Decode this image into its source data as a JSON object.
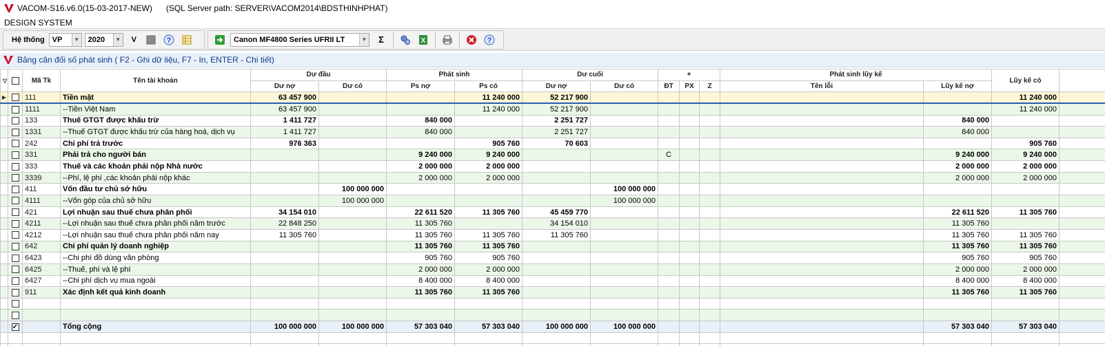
{
  "window": {
    "title": "VACOM-S16.v6.0(15-03-2017-NEW)",
    "sql_path": "(SQL Server path: SERVER\\VACOM2014\\BDSTHINHPHAT)"
  },
  "menu": {
    "label": "DESIGN SYSTEM"
  },
  "toolbar": {
    "system_label": "Hệ thống",
    "unit_value": "VP",
    "year_value": "2020",
    "v_label": "V",
    "printer_value": "Canon MF4800 Series UFRII LT",
    "sigma_label": "Σ"
  },
  "panel": {
    "title": "Bảng cân đối số phát sinh ( F2 - Ghi dữ liệu, F7 - In, ENTER - Chi tiết)"
  },
  "table": {
    "headers": {
      "ma_tk": "Mã Tk",
      "ten_tk": "Tên tài khoản",
      "du_dau": "Dư đầu",
      "phat_sinh": "Phát sinh",
      "du_cuoi": "Dư cuối",
      "plus": "+",
      "ps_luy_ke": "Phát sinh lũy kế",
      "luy_ke_co": "Lũy kế có",
      "du_no": "Dư nợ",
      "du_co": "Dư có",
      "ps_no": "Ps nợ",
      "ps_co": "Ps có",
      "du_no2": "Dư nợ",
      "du_co2": "Dư có",
      "dt": "ĐT",
      "px": "PX",
      "z": "Z",
      "ten_loi": "Tên lỗi",
      "luy_ke_no": "Lũy kế nợ"
    },
    "rows": [
      {
        "code": "111",
        "name": "Tiền mặt",
        "du_no": "63 457 900",
        "du_co": "",
        "ps_no": "",
        "ps_co": "11 240 000",
        "dc_no": "52 217 900",
        "dc_co": "",
        "dt": "",
        "px": "",
        "z": "",
        "loi": "",
        "lk_no": "",
        "lk_co": "11 240 000",
        "bold": true
      },
      {
        "code": "1111",
        "name": "--Tiền Việt Nam",
        "du_no": "63 457 900",
        "du_co": "",
        "ps_no": "",
        "ps_co": "11 240 000",
        "dc_no": "52 217 900",
        "dc_co": "",
        "dt": "",
        "px": "",
        "z": "",
        "loi": "",
        "lk_no": "",
        "lk_co": "11 240 000",
        "bold": false
      },
      {
        "code": "133",
        "name": "Thuế GTGT được khấu trừ",
        "du_no": "1 411 727",
        "du_co": "",
        "ps_no": "840 000",
        "ps_co": "",
        "dc_no": "2 251 727",
        "dc_co": "",
        "dt": "",
        "px": "",
        "z": "",
        "loi": "",
        "lk_no": "840 000",
        "lk_co": "",
        "bold": true
      },
      {
        "code": "1331",
        "name": "--Thuế GTGT được khấu trừ của hàng hoá, dịch vụ",
        "du_no": "1 411 727",
        "du_co": "",
        "ps_no": "840 000",
        "ps_co": "",
        "dc_no": "2 251 727",
        "dc_co": "",
        "dt": "",
        "px": "",
        "z": "",
        "loi": "",
        "lk_no": "840 000",
        "lk_co": "",
        "bold": false
      },
      {
        "code": "242",
        "name": "Chi phí trả trước",
        "du_no": "976 363",
        "du_co": "",
        "ps_no": "",
        "ps_co": "905 760",
        "dc_no": "70 603",
        "dc_co": "",
        "dt": "",
        "px": "",
        "z": "",
        "loi": "",
        "lk_no": "",
        "lk_co": "905 760",
        "bold": true
      },
      {
        "code": "331",
        "name": "Phải trả cho người bán",
        "du_no": "",
        "du_co": "",
        "ps_no": "9 240 000",
        "ps_co": "9 240 000",
        "dc_no": "",
        "dc_co": "",
        "dt": "C",
        "px": "",
        "z": "",
        "loi": "",
        "lk_no": "9 240 000",
        "lk_co": "9 240 000",
        "bold": true
      },
      {
        "code": "333",
        "name": "Thuế và các khoản phải nộp Nhà nước",
        "du_no": "",
        "du_co": "",
        "ps_no": "2 000 000",
        "ps_co": "2 000 000",
        "dc_no": "",
        "dc_co": "",
        "dt": "",
        "px": "",
        "z": "",
        "loi": "",
        "lk_no": "2 000 000",
        "lk_co": "2 000 000",
        "bold": true
      },
      {
        "code": "3339",
        "name": "--Phí, lệ phí ,các khoản phải nộp khác",
        "du_no": "",
        "du_co": "",
        "ps_no": "2 000 000",
        "ps_co": "2 000 000",
        "dc_no": "",
        "dc_co": "",
        "dt": "",
        "px": "",
        "z": "",
        "loi": "",
        "lk_no": "2 000 000",
        "lk_co": "2 000 000",
        "bold": false
      },
      {
        "code": "411",
        "name": "Vốn đầu tư chủ sở hữu",
        "du_no": "",
        "du_co": "100 000 000",
        "ps_no": "",
        "ps_co": "",
        "dc_no": "",
        "dc_co": "100 000 000",
        "dt": "",
        "px": "",
        "z": "",
        "loi": "",
        "lk_no": "",
        "lk_co": "",
        "bold": true
      },
      {
        "code": "4111",
        "name": "--Vốn góp của chủ sở hữu",
        "du_no": "",
        "du_co": "100 000 000",
        "ps_no": "",
        "ps_co": "",
        "dc_no": "",
        "dc_co": "100 000 000",
        "dt": "",
        "px": "",
        "z": "",
        "loi": "",
        "lk_no": "",
        "lk_co": "",
        "bold": false
      },
      {
        "code": "421",
        "name": "Lợi nhuận sau thuế chưa phân phối",
        "du_no": "34 154 010",
        "du_co": "",
        "ps_no": "22 611 520",
        "ps_co": "11 305 760",
        "dc_no": "45 459 770",
        "dc_co": "",
        "dt": "",
        "px": "",
        "z": "",
        "loi": "",
        "lk_no": "22 611 520",
        "lk_co": "11 305 760",
        "bold": true
      },
      {
        "code": "4211",
        "name": "--Lợi nhuận sau thuế chưa phân phối năm trước",
        "du_no": "22 848 250",
        "du_co": "",
        "ps_no": "11 305 760",
        "ps_co": "",
        "dc_no": "34 154 010",
        "dc_co": "",
        "dt": "",
        "px": "",
        "z": "",
        "loi": "",
        "lk_no": "11 305 760",
        "lk_co": "",
        "bold": false
      },
      {
        "code": "4212",
        "name": "--Lợi nhuận sau thuế chưa phân phối năm nay",
        "du_no": "11 305 760",
        "du_co": "",
        "ps_no": "11 305 760",
        "ps_co": "11 305 760",
        "dc_no": "11 305 760",
        "dc_co": "",
        "dt": "",
        "px": "",
        "z": "",
        "loi": "",
        "lk_no": "11 305 760",
        "lk_co": "11 305 760",
        "bold": false
      },
      {
        "code": "642",
        "name": "Chi phí quản lý doanh nghiệp",
        "du_no": "",
        "du_co": "",
        "ps_no": "11 305 760",
        "ps_co": "11 305 760",
        "dc_no": "",
        "dc_co": "",
        "dt": "",
        "px": "",
        "z": "",
        "loi": "",
        "lk_no": "11 305 760",
        "lk_co": "11 305 760",
        "bold": true
      },
      {
        "code": "6423",
        "name": "--Chi phí đồ dùng văn phòng",
        "du_no": "",
        "du_co": "",
        "ps_no": "905 760",
        "ps_co": "905 760",
        "dc_no": "",
        "dc_co": "",
        "dt": "",
        "px": "",
        "z": "",
        "loi": "",
        "lk_no": "905 760",
        "lk_co": "905 760",
        "bold": false
      },
      {
        "code": "6425",
        "name": "--Thuế, phí và lệ phí",
        "du_no": "",
        "du_co": "",
        "ps_no": "2 000 000",
        "ps_co": "2 000 000",
        "dc_no": "",
        "dc_co": "",
        "dt": "",
        "px": "",
        "z": "",
        "loi": "",
        "lk_no": "2 000 000",
        "lk_co": "2 000 000",
        "bold": false
      },
      {
        "code": "6427",
        "name": "--Chi phí dịch vụ mua ngoài",
        "du_no": "",
        "du_co": "",
        "ps_no": "8 400 000",
        "ps_co": "8 400 000",
        "dc_no": "",
        "dc_co": "",
        "dt": "",
        "px": "",
        "z": "",
        "loi": "",
        "lk_no": "8 400 000",
        "lk_co": "8 400 000",
        "bold": false
      },
      {
        "code": "911",
        "name": "Xác định kết quả kinh doanh",
        "du_no": "",
        "du_co": "",
        "ps_no": "11 305 760",
        "ps_co": "11 305 760",
        "dc_no": "",
        "dc_co": "",
        "dt": "",
        "px": "",
        "z": "",
        "loi": "",
        "lk_no": "11 305 760",
        "lk_co": "11 305 760",
        "bold": true
      },
      {
        "code": "",
        "name": "",
        "du_no": "",
        "du_co": "",
        "ps_no": "",
        "ps_co": "",
        "dc_no": "",
        "dc_co": "",
        "dt": "",
        "px": "",
        "z": "",
        "loi": "",
        "lk_no": "",
        "lk_co": "",
        "bold": false
      },
      {
        "code": "",
        "name": "",
        "du_no": "",
        "du_co": "",
        "ps_no": "",
        "ps_co": "",
        "dc_no": "",
        "dc_co": "",
        "dt": "",
        "px": "",
        "z": "",
        "loi": "",
        "lk_no": "",
        "lk_co": "",
        "bold": false
      }
    ],
    "total": {
      "name": "Tổng cộng",
      "du_no": "100 000 000",
      "du_co": "100 000 000",
      "ps_no": "57 303 040",
      "ps_co": "57 303 040",
      "dc_no": "100 000 000",
      "dc_co": "100 000 000",
      "lk_no": "57 303 040",
      "lk_co": "57 303 040",
      "checked": true
    },
    "current_row_index": 0
  },
  "colors": {
    "row_alt": "#ebf7e9",
    "row_current": "#fff6d5",
    "panel_bg": "#e9f0f8",
    "title_blue": "#0a3a8a"
  }
}
